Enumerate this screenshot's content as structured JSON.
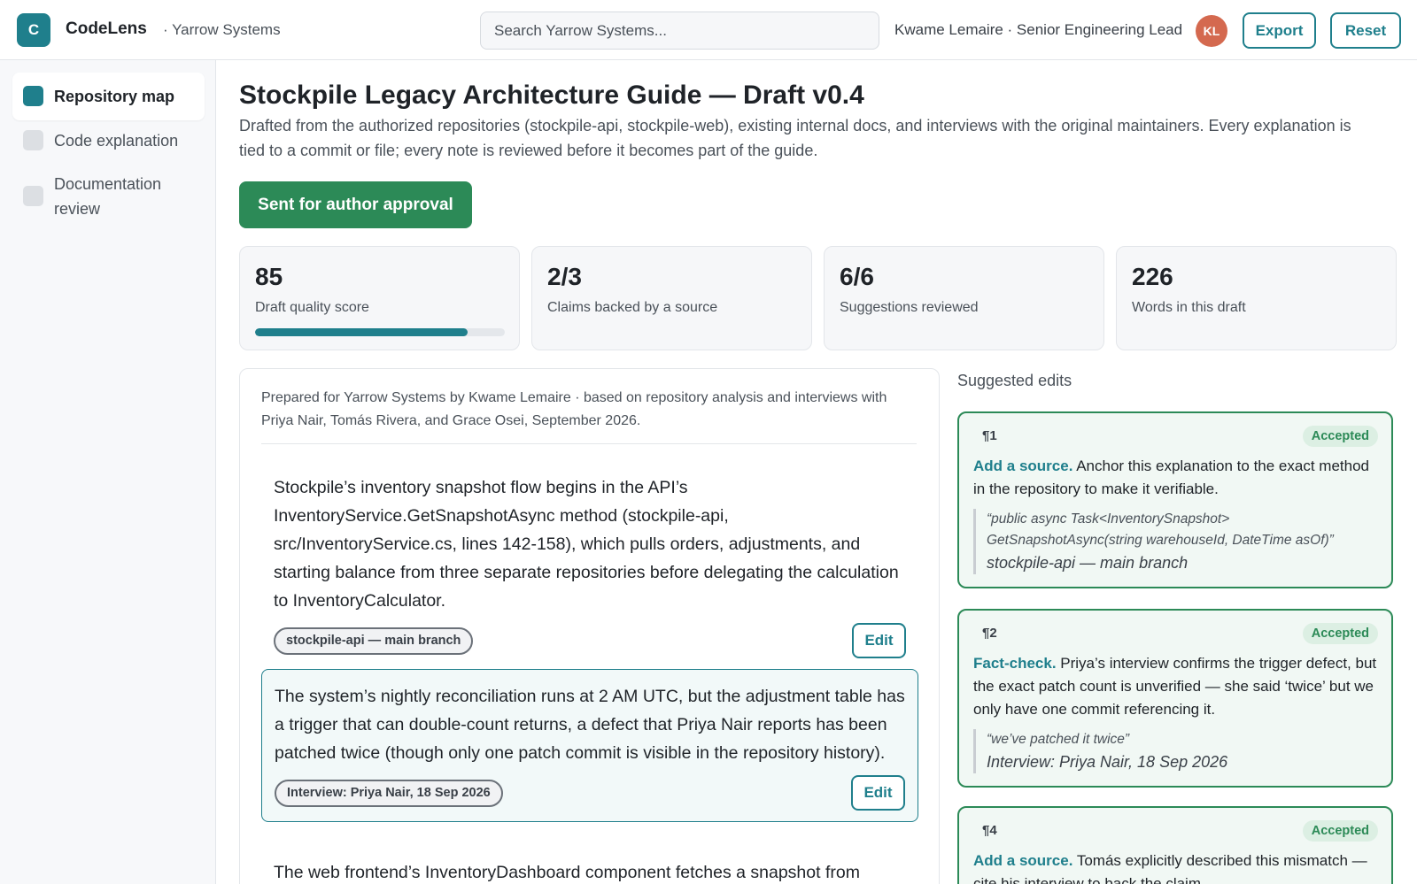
{
  "app": {
    "logo_letter": "C",
    "name": "CodeLens",
    "org": "· Yarrow Systems"
  },
  "search": {
    "placeholder": "Search Yarrow Systems..."
  },
  "user": {
    "line": "Kwame Lemaire · Senior Engineering Lead",
    "initials": "KL"
  },
  "actions": {
    "export_label": "Export",
    "reset_label": "Reset"
  },
  "sidebar": {
    "items": [
      {
        "label": "Repository map",
        "active": true
      },
      {
        "label": "Code explanation",
        "active": false
      },
      {
        "label": "Documentation review",
        "active": false
      }
    ]
  },
  "page": {
    "title": "Stockpile Legacy Architecture Guide — Draft v0.4",
    "subtitle": "Drafted from the authorized repositories (stockpile-api, stockpile-web), existing internal docs, and interviews with the original maintainers. Every explanation is tied to a commit or file; every note is reviewed before it becomes part of the guide.",
    "status_label": "Sent for author approval"
  },
  "stats": [
    {
      "value": "85",
      "label": "Draft quality score",
      "progress": 0.85
    },
    {
      "value": "2/3",
      "label": "Claims backed by a source"
    },
    {
      "value": "6/6",
      "label": "Suggestions reviewed"
    },
    {
      "value": "226",
      "label": "Words in this draft"
    }
  ],
  "document": {
    "meta": "Prepared for Yarrow Systems by Kwame Lemaire · based on repository analysis and interviews with Priya Nair, Tomás Rivera, and Grace Osei, September 2026.",
    "paragraphs": [
      {
        "text": "Stockpile’s inventory snapshot flow begins in the API’s InventoryService.GetSnapshotAsync method (stockpile-api, src/InventoryService.cs, lines 142-158), which pulls orders, adjustments, and starting balance from three separate repositories before delegating the calculation to InventoryCalculator.",
        "source": "stockpile-api — main branch",
        "edit_label": "Edit"
      },
      {
        "text": "The system’s nightly reconciliation runs at 2 AM UTC, but the adjustment table has a trigger that can double-count returns, a defect that Priya Nair reports has been patched twice (though only one patch commit is visible in the repository history).",
        "source": "Interview: Priya Nair, 18 Sep 2026",
        "edit_label": "Edit"
      },
      {
        "text": "The web frontend’s InventoryDashboard component fetches a snapshot from"
      }
    ]
  },
  "suggestions": {
    "heading": "Suggested edits",
    "items": [
      {
        "para": "¶1",
        "status": "Accepted",
        "kind": "Add a source.",
        "body": "Anchor this explanation to the exact method in the repository to make it verifiable.",
        "quote": "“public async Task<InventorySnapshot> GetSnapshotAsync(string warehouseId, DateTime asOf)”",
        "source": "stockpile-api — main branch"
      },
      {
        "para": "¶2",
        "status": "Accepted",
        "kind": "Fact-check.",
        "body": "Priya’s interview confirms the trigger defect, but the exact patch count is unverified — she said ‘twice’ but we only have one commit referencing it.",
        "quote": "“we’ve patched it twice”",
        "source": "Interview: Priya Nair, 18 Sep 2026"
      },
      {
        "para": "¶4",
        "status": "Accepted",
        "kind": "Add a source.",
        "body": "Tomás explicitly described this mismatch — cite his interview to back the claim."
      }
    ]
  },
  "colors": {
    "accent": "#1f7f8c",
    "success": "#2c8a57",
    "avatar": "#d4694f"
  }
}
